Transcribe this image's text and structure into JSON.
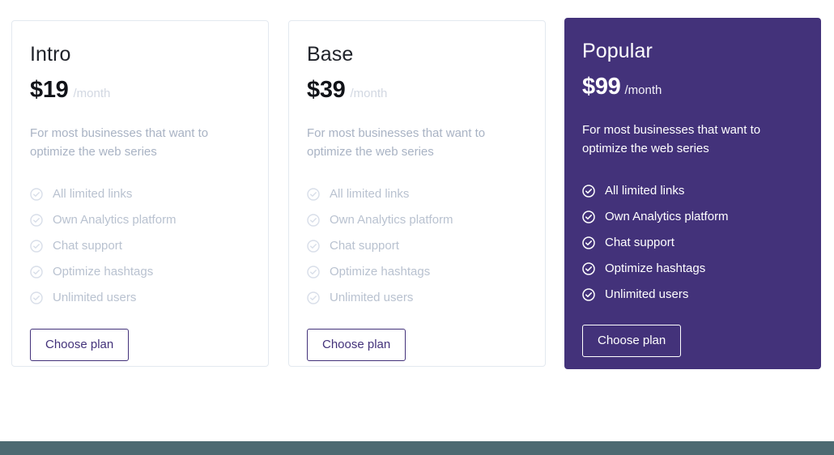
{
  "theme": {
    "accent_purple": "#43327a",
    "muted_text": "#a9b3c4",
    "card_border": "#e3e9f0",
    "footer_bar": "#4d6a72"
  },
  "plans": [
    {
      "name": "Intro",
      "price": "$19",
      "period": "/month",
      "description": "For most businesses that want to optimize the web series",
      "features": [
        "All limited links",
        "Own Analytics platform",
        "Chat support",
        "Optimize hashtags",
        "Unlimited users"
      ],
      "cta_label": "Choose plan",
      "check_icon": "circle-check-icon"
    },
    {
      "name": "Base",
      "price": "$39",
      "period": "/month",
      "description": "For most businesses that want to optimize the web series",
      "features": [
        "All limited links",
        "Own Analytics platform",
        "Chat support",
        "Optimize hashtags",
        "Unlimited users"
      ],
      "cta_label": "Choose plan",
      "check_icon": "circle-check-icon"
    },
    {
      "name": "Popular",
      "price": "$99",
      "period": "/month",
      "description": "For most businesses that want to optimize the web series",
      "features": [
        "All limited links",
        "Own Analytics platform",
        "Chat support",
        "Optimize hashtags",
        "Unlimited users"
      ],
      "cta_label": "Choose plan",
      "check_icon": "circle-check-icon",
      "featured": true
    }
  ]
}
